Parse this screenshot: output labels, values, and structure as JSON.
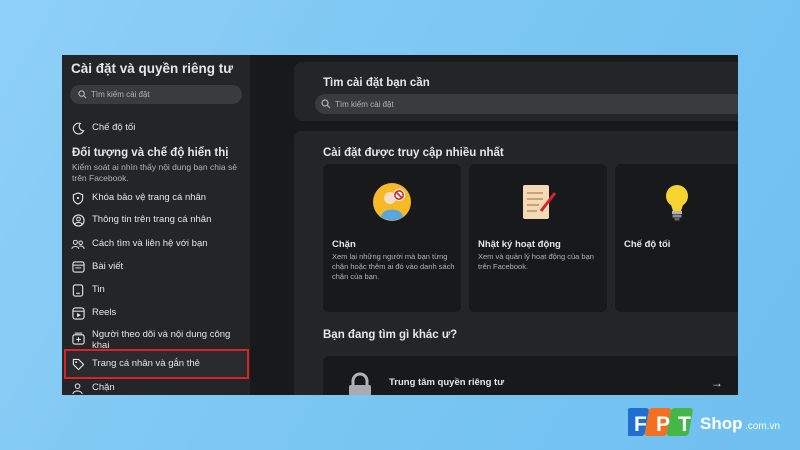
{
  "sidebar": {
    "title": "Cài đặt và quyền riêng tư",
    "search_placeholder": "Tìm kiếm cài đặt",
    "dark_mode": "Chế độ tối",
    "section_title": "Đối tượng và chế độ hiển thị",
    "section_desc": "Kiểm soát ai nhìn thấy nội dung bạn chia sẻ trên Facebook.",
    "items": [
      {
        "label": "Khóa bảo vệ trang cá nhân",
        "icon": "shield-icon"
      },
      {
        "label": "Thông tin trên trang cá nhân",
        "icon": "profile-icon"
      },
      {
        "label": "Cách tìm và liên hệ với bạn",
        "icon": "people-icon"
      },
      {
        "label": "Bài viết",
        "icon": "post-icon"
      },
      {
        "label": "Tin",
        "icon": "story-icon"
      },
      {
        "label": "Reels",
        "icon": "reels-icon"
      },
      {
        "label": "Người theo dõi và nội dung công khai",
        "icon": "followers-icon"
      },
      {
        "label": "Trang cá nhân và gắn thẻ",
        "icon": "tag-icon"
      },
      {
        "label": "Chặn",
        "icon": "block-icon"
      }
    ]
  },
  "search_card": {
    "title": "Tìm cài đặt bạn cần",
    "placeholder": "Tìm kiếm cài đặt"
  },
  "most_visited": {
    "title": "Cài đặt được truy cập nhiều nhất",
    "tiles": [
      {
        "title": "Chặn",
        "desc": "Xem lại những người mà bạn từng chặn hoặc thêm ai đó vào danh sách chặn của bạn.",
        "icon": "block-person-icon"
      },
      {
        "title": "Nhật ký hoạt động",
        "desc": "Xem và quản lý hoạt động của bạn trên Facebook.",
        "icon": "activity-log-icon"
      },
      {
        "title": "Chế độ tối",
        "desc": "",
        "icon": "lightbulb-icon"
      }
    ]
  },
  "other": {
    "title": "Bạn đang tìm gì khác ư?",
    "privacy_center": "Trung tâm quyền riêng tư"
  },
  "brand": {
    "fpt": "FPT",
    "shop": "Shop",
    "domain": ".com.vn",
    "colors": {
      "blue": "#1f6fd1",
      "orange": "#f37021",
      "green": "#45b649"
    }
  }
}
